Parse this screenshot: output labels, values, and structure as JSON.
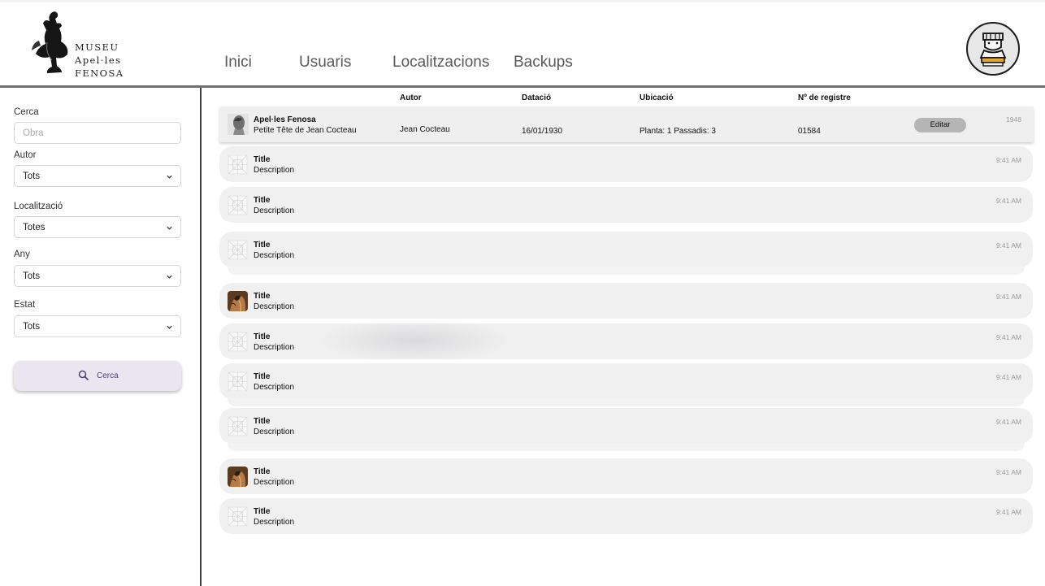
{
  "logo": {
    "line1": "MUSEU",
    "line2": "Apel·les",
    "line3": "FENOSA"
  },
  "nav": {
    "items": [
      "Inici",
      "Usuaris",
      "Localitzacions",
      "Backups"
    ]
  },
  "user": {
    "avatar_icon": "sculpture-bust-icon"
  },
  "sidebar": {
    "search_label": "Cerca",
    "search_placeholder": "Obra",
    "filters": [
      {
        "label": "Autor",
        "value": "Tots"
      },
      {
        "label": "Localització",
        "value": "Totes"
      },
      {
        "label": "Any",
        "value": "Tots"
      },
      {
        "label": "Estat",
        "value": "Tots"
      }
    ],
    "search_button": "Cerca"
  },
  "table": {
    "headers": {
      "autor": "Autor",
      "datacio": "Datació",
      "ubicacio": "Ubicació",
      "registre": "Nº de registre"
    },
    "first_row": {
      "title": "Apel·les Fenosa",
      "subtitle": "Petite Tête de Jean Cocteau",
      "autor": "Jean Cocteau",
      "datacio": "16/01/1930",
      "ubicacio": "Planta: 1 Passadis: 3",
      "registre": "01584",
      "edit_label": "Editar",
      "year": "1948"
    },
    "rows": [
      {
        "title": "Title",
        "description": "Description",
        "time": "9:41 AM",
        "thumb": "placeholder"
      },
      {
        "title": "Title",
        "description": "Description",
        "time": "9:41 AM",
        "thumb": "placeholder"
      },
      {
        "title": "Title",
        "description": "Description",
        "time": "9:41 AM",
        "thumb": "placeholder"
      },
      {
        "title": "Title",
        "description": "Description",
        "time": "9:41 AM",
        "thumb": "photo"
      },
      {
        "title": "Title",
        "description": "Description",
        "time": "9:41 AM",
        "thumb": "placeholder"
      },
      {
        "title": "Title",
        "description": "Description",
        "time": "9:41 AM",
        "thumb": "placeholder"
      },
      {
        "title": "Title",
        "description": "Description",
        "time": "9:41 AM",
        "thumb": "placeholder"
      },
      {
        "title": "Title",
        "description": "Description",
        "time": "9:41 AM",
        "thumb": "photo"
      },
      {
        "title": "Title",
        "description": "Description",
        "time": "9:41 AM",
        "thumb": "placeholder"
      }
    ]
  },
  "colors": {
    "accent_button": "#ebe5f0",
    "accent_text": "#4d3f75",
    "card_bg": "#f0f0f0",
    "divider": "#6f6f76"
  }
}
